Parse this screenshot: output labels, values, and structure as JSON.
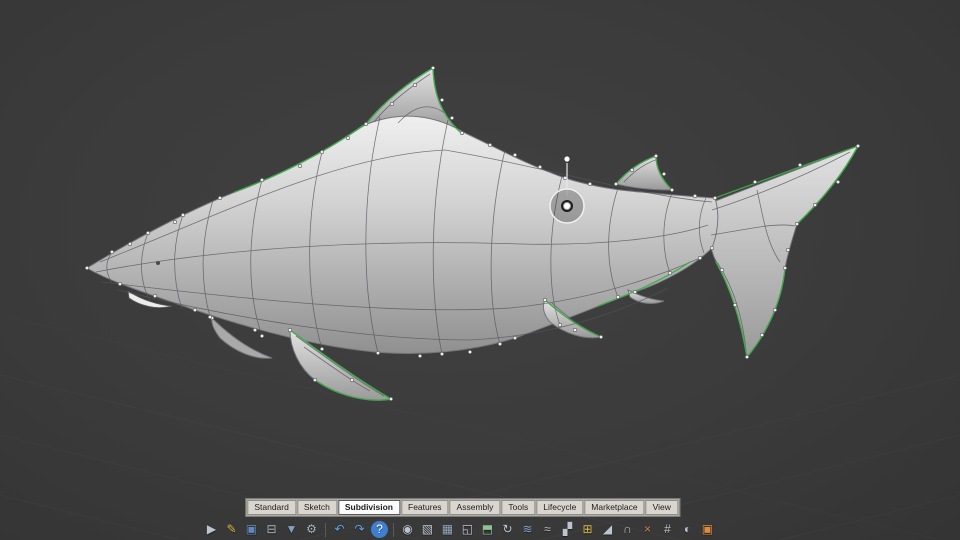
{
  "colors": {
    "viewport_background": "#3a3a3a",
    "edge_highlight_green": "#3fae49",
    "wireframe": "#54545a",
    "model_light": "#ececec",
    "model_dark": "#8f8f8f",
    "gizmo": "#f0f0f0"
  },
  "viewport": {
    "content": "subdivision surface shark model with control cage, green highlighted edges and move gizmo",
    "gizmo_icon": "move-gizmo"
  },
  "tabs": {
    "items": [
      {
        "label": "Standard",
        "active": false
      },
      {
        "label": "Sketch",
        "active": false
      },
      {
        "label": "Subdivision",
        "active": true
      },
      {
        "label": "Features",
        "active": false
      },
      {
        "label": "Assembly",
        "active": false
      },
      {
        "label": "Tools",
        "active": false
      },
      {
        "label": "Lifecycle",
        "active": false
      },
      {
        "label": "Marketplace",
        "active": false
      },
      {
        "label": "View",
        "active": false
      }
    ]
  },
  "toolbar": {
    "icons": [
      {
        "name": "select-icon",
        "glyph": "▶",
        "color": "#b9c6d4"
      },
      {
        "name": "sketch-icon",
        "glyph": "✎",
        "color": "#d7b84b"
      },
      {
        "name": "save-icon",
        "glyph": "▣",
        "color": "#6189bb"
      },
      {
        "name": "print-icon",
        "glyph": "⊟",
        "color": "#a9b4c1"
      },
      {
        "name": "export-icon",
        "glyph": "▼",
        "color": "#7fa3c6"
      },
      {
        "name": "settings-gear-icon",
        "glyph": "⚙",
        "color": "#aab4c0"
      },
      {
        "name": "undo-icon",
        "glyph": "↶",
        "color": "#58a6e8"
      },
      {
        "name": "redo-icon",
        "glyph": "↷",
        "color": "#58a6e8"
      },
      {
        "name": "help-icon",
        "glyph": "?",
        "color": "#ffffff",
        "bg": "#3f7fd0",
        "round": true
      },
      {
        "name": "sphere-icon",
        "glyph": "◉",
        "color": "#bcc5cf"
      },
      {
        "name": "box-icon",
        "glyph": "▧",
        "color": "#bcc5cf"
      },
      {
        "name": "mesh-icon",
        "glyph": "▦",
        "color": "#93aac2"
      },
      {
        "name": "plane-icon",
        "glyph": "◱",
        "color": "#bcc5cf"
      },
      {
        "name": "extrude-icon",
        "glyph": "⬒",
        "color": "#8fbf92"
      },
      {
        "name": "revolve-icon",
        "glyph": "↻",
        "color": "#bcc5cf"
      },
      {
        "name": "loft-icon",
        "glyph": "≋",
        "color": "#7fa3c6"
      },
      {
        "name": "sweep-icon",
        "glyph": "≈",
        "color": "#bcc5cf"
      },
      {
        "name": "mirror-icon",
        "glyph": "▞",
        "color": "#bcc5cf"
      },
      {
        "name": "subdivide-icon",
        "glyph": "⊞",
        "color": "#d7b84b"
      },
      {
        "name": "crease-icon",
        "glyph": "◢",
        "color": "#bcc5cf"
      },
      {
        "name": "bridge-icon",
        "glyph": "∩",
        "color": "#bcc5cf"
      },
      {
        "name": "trim-icon",
        "glyph": "×",
        "color": "#cf8050"
      },
      {
        "name": "measure-icon",
        "glyph": "#",
        "color": "#bcc5cf"
      },
      {
        "name": "material-icon",
        "glyph": "◐",
        "color": "#bcc5cf"
      },
      {
        "name": "marketplace-icon",
        "glyph": "▣",
        "color": "#e08a3c"
      }
    ]
  }
}
